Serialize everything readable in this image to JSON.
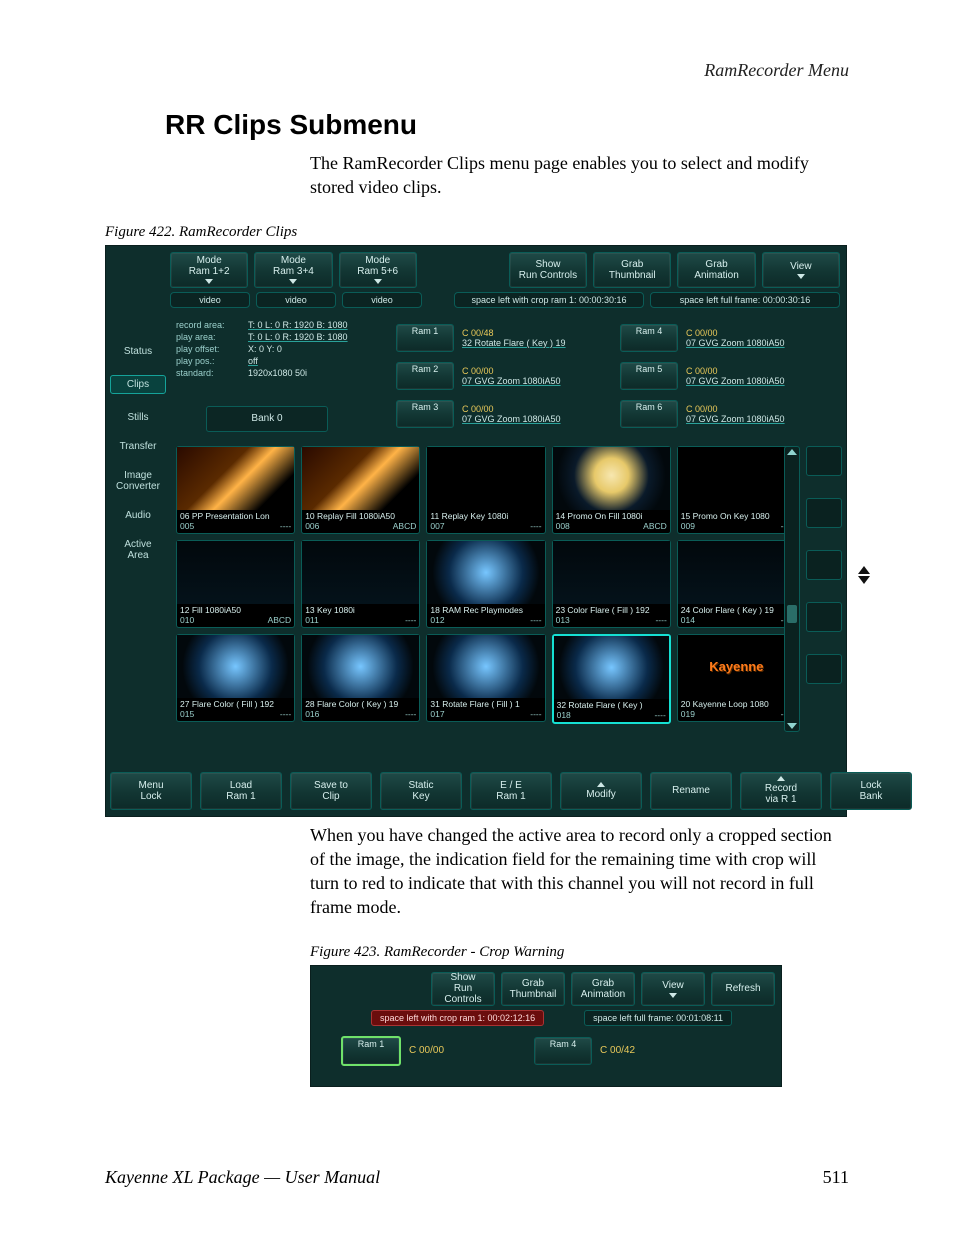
{
  "page": {
    "running_head": "RamRecorder Menu",
    "title": "RR Clips Submenu",
    "para1": "The RamRecorder Clips menu page enables you to select and modify stored video clips.",
    "fig422_caption": "Figure 422.  RamRecorder Clips",
    "para2": "When you have changed the active area to record only a cropped section of the image, the indication field for the remaining time with crop will turn to red to indicate that with this channel you will not record in full frame mode.",
    "fig423_caption": "Figure 423.  RamRecorder - Crop Warning",
    "footer_left": "Kayenne XL Package — User Manual",
    "footer_right": "511"
  },
  "fig422": {
    "top": {
      "mode12": {
        "l1": "Mode",
        "l2": "Ram 1+2"
      },
      "mode34": {
        "l1": "Mode",
        "l2": "Ram 3+4"
      },
      "mode56": {
        "l1": "Mode",
        "l2": "Ram 5+6"
      },
      "show": {
        "l1": "Show",
        "l2": "Run Controls"
      },
      "grab_t": {
        "l1": "Grab",
        "l2": "Thumbnail"
      },
      "grab_a": {
        "l1": "Grab",
        "l2": "Animation"
      },
      "view": {
        "l1": "View",
        "l2": ""
      }
    },
    "pills": {
      "video": "video",
      "crop": "space left with crop ram 1: 00:00:30:16",
      "full": "space left full frame: 00:00:30:16"
    },
    "info": {
      "record_area_k": "record area:",
      "record_area_v": "T: 0  L: 0  R: 1920  B: 1080",
      "play_area_k": "play area:",
      "play_area_v": "T: 0  L: 0  R: 1920  B: 1080",
      "play_offset_k": "play offset:",
      "play_offset_v": "X: 0  Y: 0",
      "play_pos_k": "play pos.:",
      "play_pos_v": "off",
      "standard_k": "standard:",
      "standard_v": "1920x1080 50i"
    },
    "bank": "Bank 0",
    "rail": {
      "status": "Status",
      "clips": "Clips",
      "stills": "Stills",
      "transfer": "Transfer",
      "imgconv1": "Image",
      "imgconv2": "Converter",
      "audio": "Audio",
      "active1": "Active",
      "active2": "Area"
    },
    "ram": {
      "b1": "Ram 1",
      "b2": "Ram 2",
      "b3": "Ram 3",
      "b4": "Ram 4",
      "b5": "Ram 5",
      "b6": "Ram 6",
      "r1": {
        "c": "C 00/48",
        "n": "32 Rotate Flare ( Key ) 19"
      },
      "r2": {
        "c": "C 00/00",
        "n": "07 GVG Zoom 1080iA50"
      },
      "r3": {
        "c": "C 00/00",
        "n": "07 GVG Zoom 1080iA50"
      },
      "r4": {
        "c": "C 00/00",
        "n": "07 GVG Zoom 1080iA50"
      },
      "r5": {
        "c": "C 00/00",
        "n": "07 GVG Zoom 1080iA50"
      },
      "r6": {
        "c": "C 00/00",
        "n": "07 GVG Zoom 1080iA50"
      }
    },
    "thumbs": [
      {
        "t": "06 PP Presentation Lon",
        "id": "005",
        "m": "----",
        "img": "flare"
      },
      {
        "t": "10 Replay Fill 1080iA50",
        "id": "006",
        "m": "ABCD",
        "img": "flare"
      },
      {
        "t": "11 Replay Key 1080i",
        "id": "007",
        "m": "----",
        "img": "black"
      },
      {
        "t": "14 Promo On Fill 1080i",
        "id": "008",
        "m": "ABCD",
        "img": "orb"
      },
      {
        "t": "15 Promo On Key 1080",
        "id": "009",
        "m": "----",
        "img": "black"
      },
      {
        "t": "12 Fill 1080iA50",
        "id": "010",
        "m": "ABCD",
        "img": "dark"
      },
      {
        "t": "13 Key 1080i",
        "id": "011",
        "m": "----",
        "img": "dark"
      },
      {
        "t": "18 RAM Rec Playmodes",
        "id": "012",
        "m": "----",
        "img": "blue"
      },
      {
        "t": "23 Color Flare ( Fill ) 192",
        "id": "013",
        "m": "----",
        "img": "dark"
      },
      {
        "t": "24 Color Flare ( Key ) 19",
        "id": "014",
        "m": "----",
        "img": "dark"
      },
      {
        "t": "27 Flare Color ( Fill ) 192",
        "id": "015",
        "m": "----",
        "img": "blue"
      },
      {
        "t": "28 Flare Color ( Key ) 19",
        "id": "016",
        "m": "----",
        "img": "blue"
      },
      {
        "t": "31 Rotate Flare ( Fill ) 1",
        "id": "017",
        "m": "----",
        "img": "blue"
      },
      {
        "t": "32 Rotate Flare ( Key )",
        "id": "018",
        "m": "----",
        "img": "blue",
        "sel": true
      },
      {
        "t": "20 Kayenne Loop 1080",
        "id": "019",
        "m": "----",
        "img": "brand",
        "brand": "Kayenne"
      }
    ],
    "bottom": {
      "menulock": {
        "l1": "Menu",
        "l2": "Lock"
      },
      "load": {
        "l1": "Load",
        "l2": "Ram 1"
      },
      "save": {
        "l1": "Save to",
        "l2": "Clip"
      },
      "statickey": {
        "l1": "Static",
        "l2": "Key"
      },
      "ee": {
        "l1": "E / E",
        "l2": "Ram 1"
      },
      "modify": {
        "l1": "",
        "l2": "Modify"
      },
      "rename": {
        "l1": "",
        "l2": "Rename"
      },
      "record": {
        "l1": "Record",
        "l2": "via R 1"
      },
      "lockbank": {
        "l1": "Lock",
        "l2": "Bank"
      }
    }
  },
  "fig423": {
    "top": {
      "show": {
        "l1": "Show",
        "l2": "Run Controls"
      },
      "grab_t": {
        "l1": "Grab",
        "l2": "Thumbnail"
      },
      "grab_a": {
        "l1": "Grab",
        "l2": "Animation"
      },
      "view": {
        "l1": "View",
        "l2": ""
      },
      "refresh": {
        "l1": "Refresh",
        "l2": ""
      }
    },
    "bars": {
      "crop": "space left with crop ram 1: 00:02:12:16",
      "full": "space left full frame: 00:01:08:11"
    },
    "ram": {
      "b1": "Ram 1",
      "c1": "C 00/00",
      "b4": "Ram 4",
      "c4": "C 00/42"
    }
  }
}
